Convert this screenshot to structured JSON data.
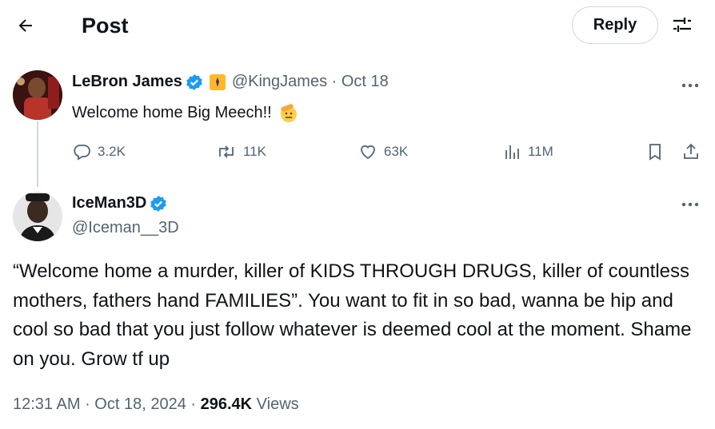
{
  "header": {
    "title": "Post",
    "reply_label": "Reply"
  },
  "parent_tweet": {
    "display_name": "LeBron James",
    "handle": "@KingJames",
    "date": "Oct 18",
    "text": "Welcome home Big Meech!!",
    "emoji": "saluting-face-icon",
    "stats": {
      "replies": "3.2K",
      "reposts": "11K",
      "likes": "63K",
      "views": "11M"
    }
  },
  "main_tweet": {
    "display_name": "IceMan3D",
    "handle": "@Iceman__3D",
    "text": "“Welcome home a murder, killer of KIDS THROUGH DRUGS, killer of countless mothers, fathers hand FAMILIES”. You want to fit in so bad, wanna be hip and cool so bad that you just follow whatever is deemed cool at the moment. Shame on you. Grow tf up",
    "time": "12:31 AM",
    "full_date": "Oct 18, 2024",
    "views_count": "296.4K",
    "views_label": "Views"
  },
  "colors": {
    "verified_blue": "#1d9bf0",
    "secondary_text": "#536471",
    "primary_text": "#0f1419",
    "border": "#cfd9de",
    "affiliation_gold": "#fdb927"
  }
}
